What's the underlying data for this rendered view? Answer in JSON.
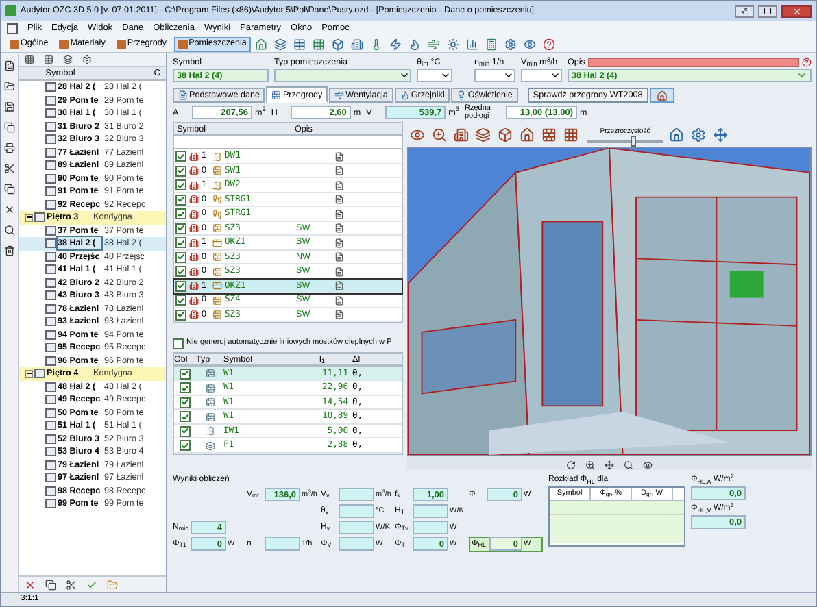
{
  "window": {
    "title": "Audytor OZC 3D 5.0  [v. 07.01.2011] - C:\\Program Files (x86)\\Audytor 5\\Pol\\Dane\\Pusty.ozd - [Pomieszczenia - Dane o pomieszczeniu]"
  },
  "menu": [
    "Plik",
    "Edycja",
    "Widok",
    "Dane",
    "Obliczenia",
    "Wyniki",
    "Parametry",
    "Okno",
    "Pomoc"
  ],
  "toolbar": [
    {
      "label": "Ogólne",
      "selected": false
    },
    {
      "label": "Materiały",
      "selected": false
    },
    {
      "label": "Przegrody",
      "selected": false
    },
    {
      "label": "Pomieszczenia",
      "selected": true
    }
  ],
  "tree": {
    "columns": [
      "Symbol",
      "C"
    ],
    "items": [
      {
        "kind": "room",
        "symbol": "28 Hal 2 (",
        "name": "28 Hal 2 (",
        "selected": false
      },
      {
        "kind": "room",
        "symbol": "29 Pom te",
        "name": "29 Pom te",
        "selected": false
      },
      {
        "kind": "room",
        "symbol": "30 Hal 1 (",
        "name": "30 Hal 1 (",
        "selected": false
      },
      {
        "kind": "room",
        "symbol": "31 Biuro 2",
        "name": "31 Biuro 2",
        "selected": false
      },
      {
        "kind": "room",
        "symbol": "32 Biuro 3",
        "name": "32 Biuro 3",
        "selected": false
      },
      {
        "kind": "room",
        "symbol": "77 Łazienl",
        "name": "77 Łazienl",
        "selected": false
      },
      {
        "kind": "room",
        "symbol": "89 Łazienl",
        "name": "89 Łazienl",
        "selected": false
      },
      {
        "kind": "room",
        "symbol": "90 Pom te",
        "name": "90 Pom te",
        "selected": false
      },
      {
        "kind": "room",
        "symbol": "91 Pom te",
        "name": "91 Pom te",
        "selected": false
      },
      {
        "kind": "room",
        "symbol": "92 Recepc",
        "name": "92 Recepc",
        "selected": false
      },
      {
        "kind": "floor",
        "symbol": "Piętro 3",
        "name": "Kondygna",
        "expanded": true,
        "children": [
          {
            "kind": "room",
            "symbol": "37 Pom te",
            "name": "37 Pom te",
            "selected": false
          },
          {
            "kind": "room",
            "symbol": "38 Hal 2 (",
            "name": "38 Hal 2 (",
            "selected": true
          },
          {
            "kind": "room",
            "symbol": "40 Przejśc",
            "name": "40 Przejśc",
            "selected": false
          },
          {
            "kind": "room",
            "symbol": "41 Hal 1 (",
            "name": "41 Hal 1 (",
            "selected": false
          },
          {
            "kind": "room",
            "symbol": "42 Biuro 2",
            "name": "42 Biuro 2",
            "selected": false
          },
          {
            "kind": "room",
            "symbol": "43 Biuro 3",
            "name": "43 Biuro 3",
            "selected": false
          },
          {
            "kind": "room",
            "symbol": "78 Łazienl",
            "name": "78 Łazienl",
            "selected": false
          },
          {
            "kind": "room",
            "symbol": "93 Łazienl",
            "name": "93 Łazienl",
            "selected": false
          },
          {
            "kind": "room",
            "symbol": "94 Pom te",
            "name": "94 Pom te",
            "selected": false
          },
          {
            "kind": "room",
            "symbol": "95 Recepc",
            "name": "95 Recepc",
            "selected": false
          },
          {
            "kind": "room",
            "symbol": "96 Pom te",
            "name": "96 Pom te",
            "selected": false
          }
        ]
      },
      {
        "kind": "floor",
        "symbol": "Piętro 4",
        "name": "Kondygna",
        "expanded": true,
        "children": [
          {
            "kind": "room",
            "symbol": "48 Hal 2 (",
            "name": "48 Hal 2 (",
            "selected": false
          },
          {
            "kind": "room",
            "symbol": "49 Recepc",
            "name": "49 Recepc",
            "selected": false
          },
          {
            "kind": "room",
            "symbol": "50 Pom te",
            "name": "50 Pom te",
            "selected": false
          },
          {
            "kind": "room",
            "symbol": "51 Hal 1 (",
            "name": "51 Hal 1 (",
            "selected": false
          },
          {
            "kind": "room",
            "symbol": "52 Biuro 3",
            "name": "52 Biuro 3",
            "selected": false
          },
          {
            "kind": "room",
            "symbol": "53 Biuro 4",
            "name": "53 Biuro 4",
            "selected": false
          },
          {
            "kind": "room",
            "symbol": "79 Łazienl",
            "name": "79 Łazienl",
            "selected": false
          },
          {
            "kind": "room",
            "symbol": "97 Łazienl",
            "name": "97 Łazienl",
            "selected": false
          },
          {
            "kind": "room",
            "symbol": "98 Recepc",
            "name": "98 Recepc",
            "selected": false
          },
          {
            "kind": "room",
            "symbol": "99 Pom te",
            "name": "99 Pom te",
            "selected": false
          }
        ]
      }
    ]
  },
  "status_bar": "3:1:1",
  "room": {
    "symbol_label": "Symbol",
    "symbol": "38 Hal 2 (4)",
    "type_label": "Typ pomieszczenia",
    "temp_label": "θ$_{int}$ °C",
    "nmin_label": "n$_{min}$ 1/h",
    "vmin_label": "V$_{min}$ m$^{3}$/h",
    "desc_label": "Opis",
    "desc": "38 Hal 2 (4)"
  },
  "tabs": [
    {
      "label": "Podstawowe dane",
      "selected": false
    },
    {
      "label": "Przegrody",
      "selected": true
    },
    {
      "label": "Wentylacja",
      "selected": false
    },
    {
      "label": "Grzejniki",
      "selected": false
    },
    {
      "label": "Oświetlenie",
      "selected": false
    }
  ],
  "check_button": "Sprawdź przegrody WT2008",
  "dims": [
    {
      "label": "A",
      "value": "207,56",
      "unit": "m$^{2}$"
    },
    {
      "label": "H",
      "value": "2,60",
      "unit": "m"
    },
    {
      "label": "V",
      "value": "539,7",
      "unit": "m$^{3}$"
    },
    {
      "label": "Rzędna podłogi",
      "value": "13,00 (13,00)",
      "unit": "m"
    }
  ],
  "partitions": {
    "columns": [
      "Symbol",
      "Opis"
    ],
    "rows": [
      {
        "checked": true,
        "count": "1",
        "kind": "door",
        "symbol": "DW1",
        "selected": false
      },
      {
        "checked": true,
        "count": "0",
        "kind": "wall",
        "symbol": "SW1",
        "selected": false
      },
      {
        "checked": true,
        "count": "1",
        "kind": "door",
        "symbol": "DW2",
        "selected": false
      },
      {
        "checked": true,
        "count": "0",
        "kind": "stairs",
        "symbol": "STRG1",
        "selected": false
      },
      {
        "checked": true,
        "count": "0",
        "kind": "stairs",
        "symbol": "STRG1",
        "selected": false
      },
      {
        "checked": true,
        "count": "0",
        "kind": "wall",
        "symbol": "SZ3",
        "side": "SW",
        "selected": false
      },
      {
        "checked": true,
        "count": "1",
        "kind": "window",
        "symbol": "OKZ1",
        "side": "SW",
        "selected": false
      },
      {
        "checked": true,
        "count": "0",
        "kind": "wall",
        "symbol": "SZ3",
        "side": "NW",
        "selected": false
      },
      {
        "checked": true,
        "count": "0",
        "kind": "wall",
        "symbol": "SZ3",
        "side": "SW",
        "selected": false
      },
      {
        "checked": true,
        "count": "1",
        "kind": "window",
        "symbol": "OKZ1",
        "side": "SW",
        "selected": true
      },
      {
        "checked": true,
        "count": "0",
        "kind": "wall",
        "symbol": "SZ4",
        "side": "SW",
        "selected": false
      },
      {
        "checked": true,
        "count": "0",
        "kind": "wall",
        "symbol": "SZ3",
        "side": "SW",
        "selected": false
      }
    ]
  },
  "no_bridges": {
    "label": "Nie generuj automatycznie liniowych mostków cieplnych w P",
    "checked": false
  },
  "bridges": {
    "columns": [
      "Obl",
      "Typ",
      "Symbol",
      "l$_{1}$",
      "Δl"
    ],
    "rows": [
      {
        "checked": true,
        "kind": "wall",
        "symbol": "W1",
        "l1": "11,11",
        "dl": "0,",
        "selected": true
      },
      {
        "checked": true,
        "kind": "wall",
        "symbol": "W1",
        "l1": "22,96",
        "dl": "0,",
        "selected": false
      },
      {
        "checked": true,
        "kind": "wall",
        "symbol": "W1",
        "l1": "14,54",
        "dl": "0,",
        "selected": false
      },
      {
        "checked": true,
        "kind": "wall",
        "symbol": "W1",
        "l1": "10,89",
        "dl": "0,",
        "selected": false
      },
      {
        "checked": true,
        "kind": "door",
        "symbol": "IW1",
        "l1": "5,00",
        "dl": "0,",
        "selected": false
      },
      {
        "checked": true,
        "kind": "floor",
        "symbol": "F1",
        "l1": "2,88",
        "dl": "0,",
        "selected": false
      }
    ]
  },
  "view": {
    "transparency_label": "Przezroczystość",
    "level": 0.62
  },
  "results": {
    "title": "Wyniki obliczeń",
    "rows": [
      [
        {
          "kind": "blank"
        },
        {
          "kind": "field",
          "label": "V$_{inf}$",
          "value": "136,0",
          "unit": "m$^{3}$/h"
        },
        {
          "kind": "field",
          "label": "V$_{v}$",
          "unit": "m$^{3}$/h"
        },
        {
          "kind": "field",
          "label": "f$_{k}$",
          "value": "1,00"
        },
        {
          "kind": "field",
          "label": "Φ",
          "value": "0",
          "unit": "W"
        }
      ],
      [
        {
          "kind": "blank"
        },
        {
          "kind": "blank"
        },
        {
          "kind": "field",
          "label": "θ$_{v}$",
          "unit": "°C"
        },
        {
          "kind": "field",
          "label": "H$_{T}$",
          "unit": "W/K"
        },
        {
          "kind": "blank"
        }
      ],
      [
        {
          "kind": "field",
          "label": "N$_{min}$",
          "value": "4"
        },
        {
          "kind": "blank"
        },
        {
          "kind": "field",
          "label": "H$_{v}$",
          "unit": "W/K"
        },
        {
          "kind": "field",
          "label": "Φ$_{Tv}$",
          "unit": "W"
        },
        {
          "kind": "blank"
        }
      ],
      [
        {
          "kind": "field",
          "label": "Φ$_{T1}$",
          "value": "0",
          "unit": "W"
        },
        {
          "kind": "field",
          "label": "n",
          "unit": "1/h"
        },
        {
          "kind": "field",
          "label": "Φ$_{V}$",
          "unit": "W"
        },
        {
          "kind": "field",
          "label": "Φ$_{T}$",
          "value": "0",
          "unit": "W"
        },
        {
          "kind": "total",
          "label": "Φ$_{HL}$",
          "value": "0",
          "unit": "W"
        }
      ]
    ]
  },
  "distribution": {
    "title": "Rozkład Φ$_{HL}$ dla",
    "columns": [
      "Symbol",
      "Φ$_{gr}$, %",
      "D$_{gr}$, W"
    ]
  },
  "per_area": [
    {
      "label": "Φ$_{HL,A}$ W/m$^{2}$",
      "value": "0,0"
    },
    {
      "label": "Φ$_{HL,V}$ W/m$^{3}$",
      "value": "0,0"
    }
  ]
}
